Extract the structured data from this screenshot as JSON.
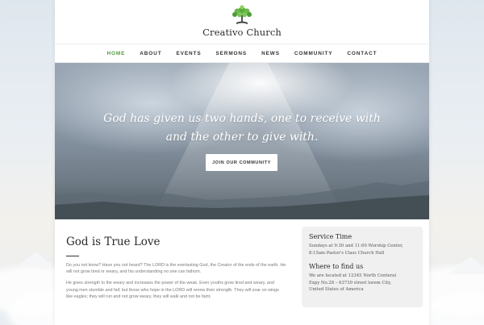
{
  "site": {
    "title": "Creativo Church"
  },
  "nav": {
    "items": [
      "HOME",
      "ABOUT",
      "EVENTS",
      "SERMONS",
      "NEWS",
      "COMMUNITY",
      "CONTACT"
    ],
    "active": "HOME"
  },
  "hero": {
    "quote_line1": "God has given us two hands, one to receive with",
    "quote_line2": "and the other to give with.",
    "button_label": "JOIN OUR COMMUNITY"
  },
  "main": {
    "heading": "God is True Love",
    "paragraph1_line1": "Do you not know? Have you not heard? The LORD is the everlasting God, the Creator of the ends of the earth. He",
    "paragraph1_line2": "will not grow tired or weary, and his understanding no one can fathom.",
    "paragraph2_line1": "He gives strength to the weary and increases the power of the weak. Even youths grow tired and weary, and",
    "paragraph2_line2": "young men stumble and fall; but those who hope in the LORD will renew their strength. They will soar on wings",
    "paragraph2_line3": "like eagles; they will run and not grow weary, they will walk and not be faint."
  },
  "sidebar": {
    "service_heading": "Service Time",
    "service_line1": "Sundays at 9:30 and 11:00 Worship Center,",
    "service_line2": "8:15am Pastor's Class Church Hall",
    "location_heading": "Where to find us",
    "location_line1": "We are located at 12345 North Centeral",
    "location_line2": "Expy No.28 – 63739 street lorem City,",
    "location_line3": "United States of America"
  },
  "colors": {
    "accent_green": "#4f9a3c",
    "tree_green": "#5aa83a"
  }
}
